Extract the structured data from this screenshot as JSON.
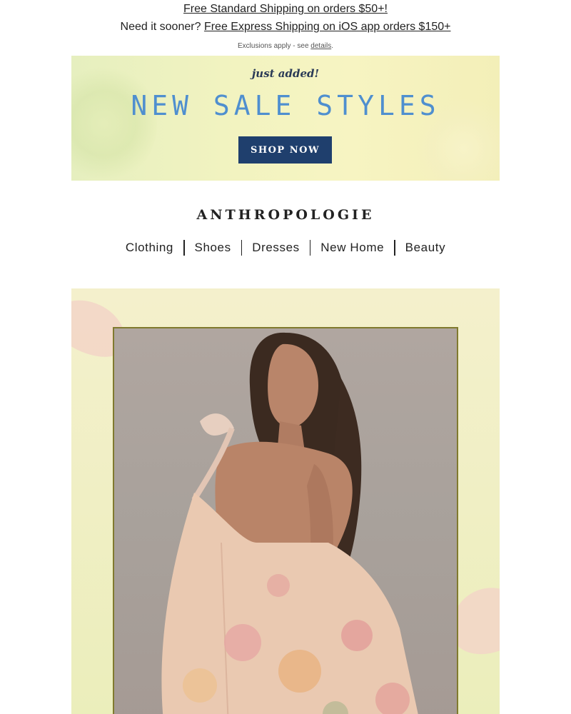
{
  "shipping": {
    "line1": "Free Standard Shipping on orders $50+!",
    "line2_prefix": "Need it sooner?",
    "line2_link": "Free Express Shipping on iOS app orders $150+",
    "exclusions_prefix": "Exclusions apply - see",
    "exclusions_link": "details",
    "exclusions_suffix": "."
  },
  "banner": {
    "eyebrow": "just added!",
    "headline": "NEW SALE STYLES",
    "cta": "SHOP NOW"
  },
  "brand": {
    "logo": "ANTHROPOLOGIE"
  },
  "nav": {
    "items": [
      {
        "label": "Clothing"
      },
      {
        "label": "Shoes"
      },
      {
        "label": "Dresses"
      },
      {
        "label": "New Home"
      },
      {
        "label": "Beauty"
      }
    ]
  },
  "colors": {
    "banner_cta_bg": "#1f3f6d",
    "headline_blue": "#4f8fcf",
    "frame_olive": "#807a2e",
    "hero_bg": "#f0efc4"
  }
}
